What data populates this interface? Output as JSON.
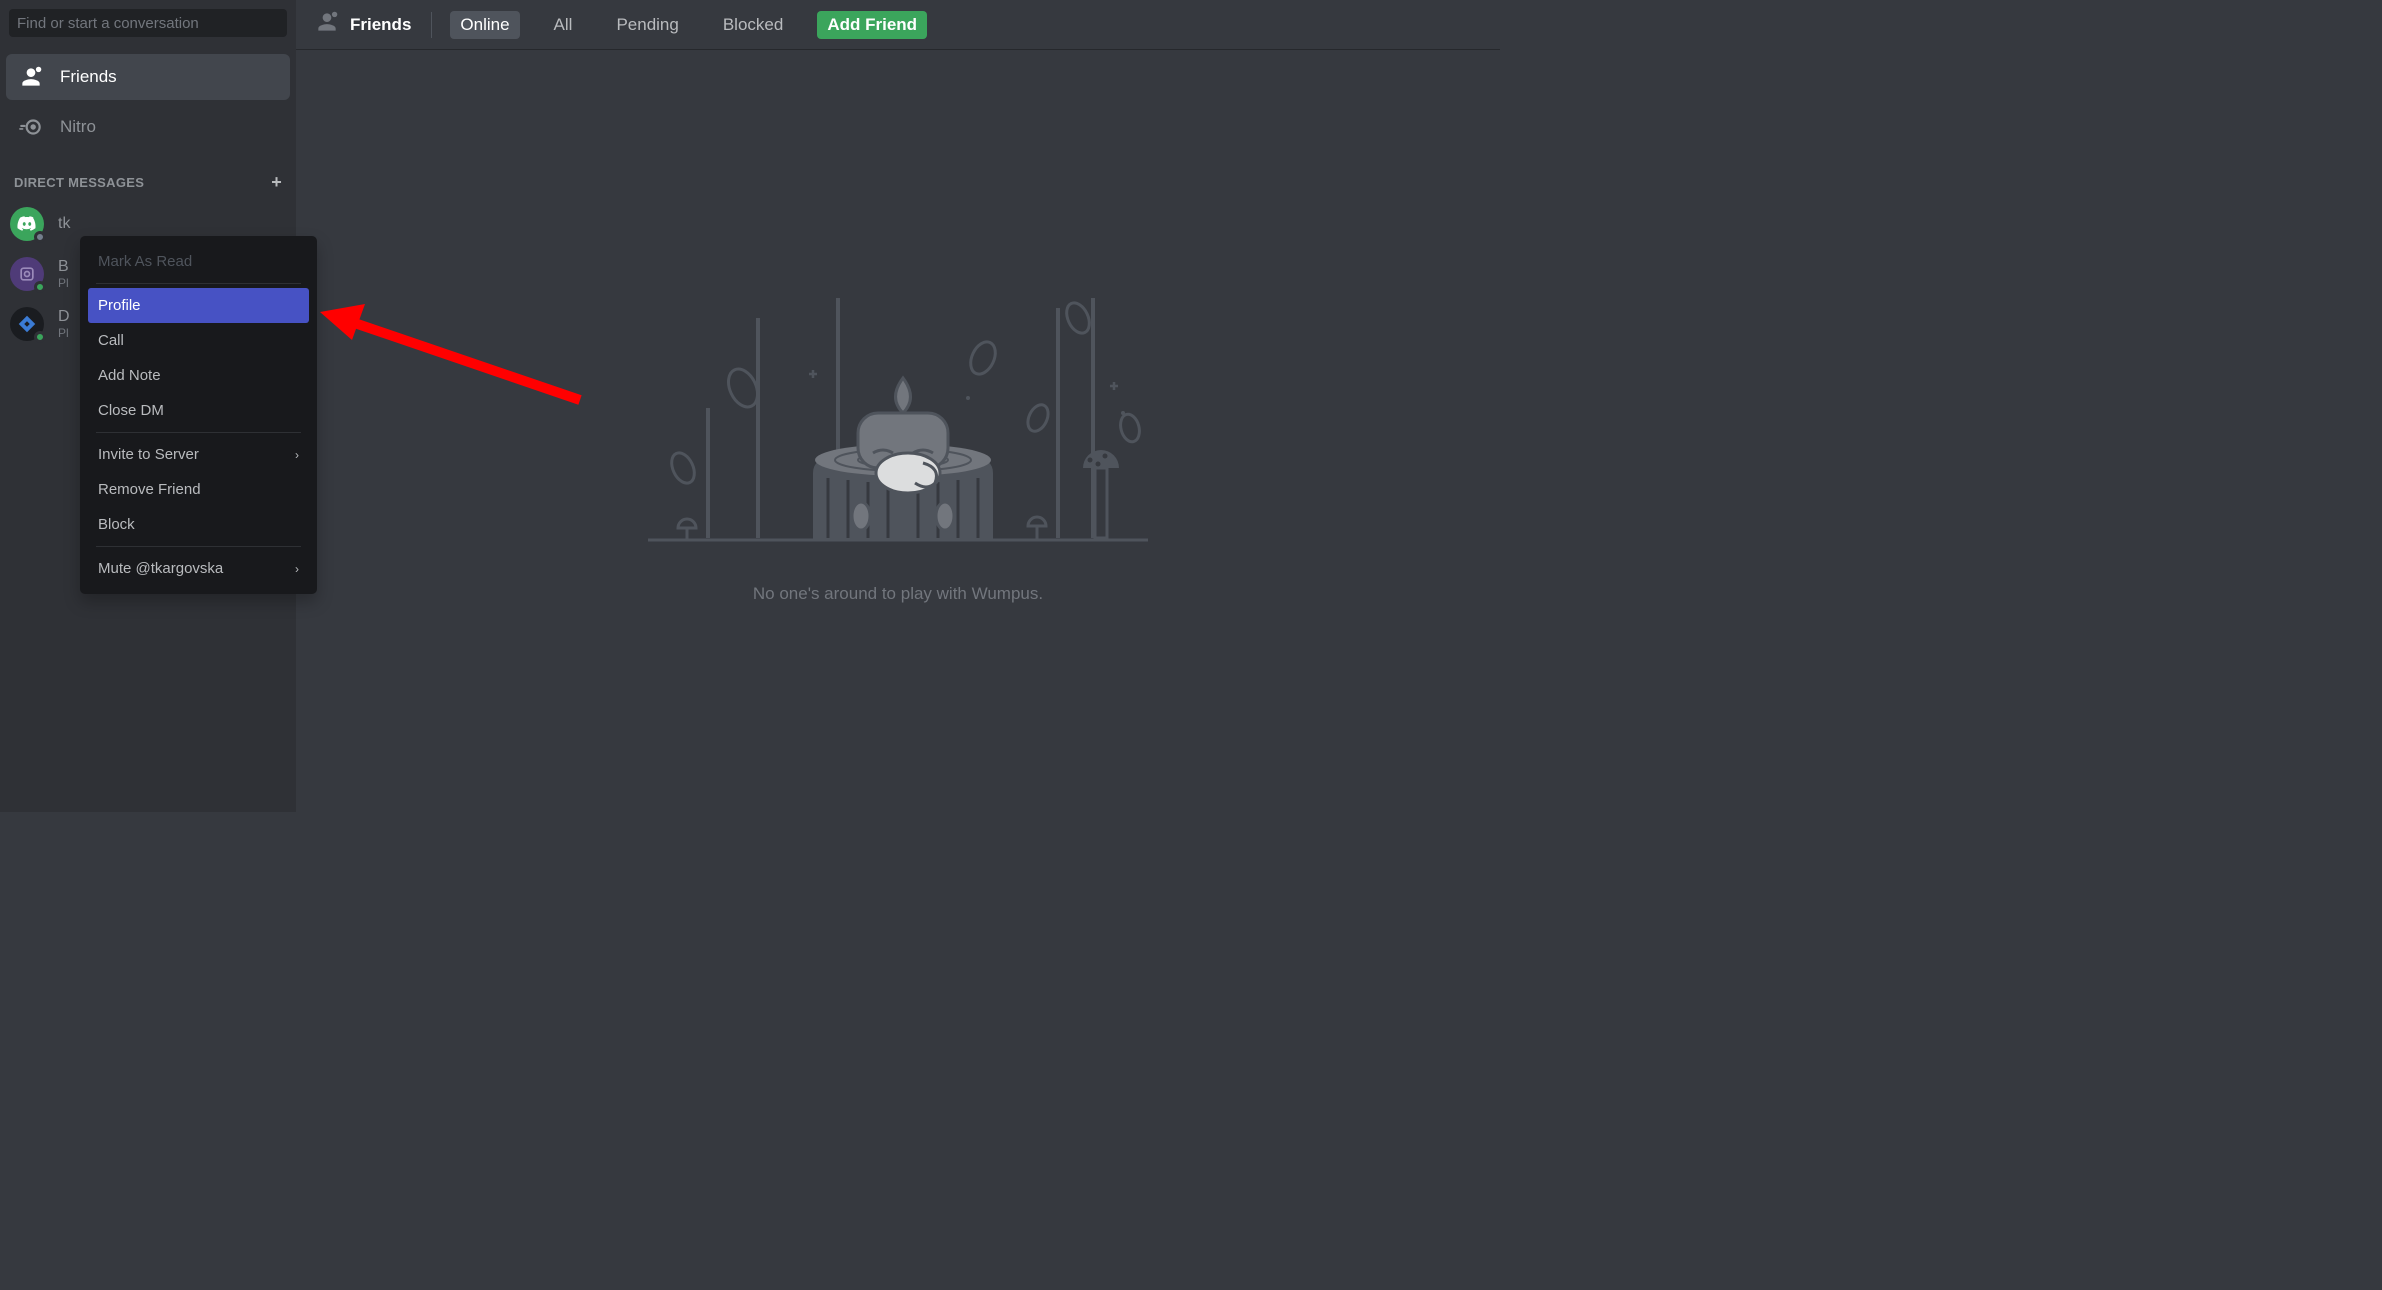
{
  "search": {
    "placeholder": "Find or start a conversation"
  },
  "sidebar": {
    "friends_label": "Friends",
    "nitro_label": "Nitro",
    "dm_header": "DIRECT MESSAGES",
    "dms": [
      {
        "name": "tk",
        "sub": "",
        "avatar_bg": "#3ba55c",
        "status": "#747f8d"
      },
      {
        "name": "B",
        "sub": "Pl",
        "avatar_bg": "#4f3b78",
        "status": "#3ba55c"
      },
      {
        "name": "D",
        "sub": "Pl",
        "avatar_bg": "#1a1c20",
        "status": "#3ba55c"
      }
    ]
  },
  "header": {
    "title": "Friends",
    "tabs": {
      "online": "Online",
      "all": "All",
      "pending": "Pending",
      "blocked": "Blocked"
    },
    "add_friend": "Add Friend"
  },
  "empty": {
    "text": "No one's around to play with Wumpus."
  },
  "context_menu": {
    "mark_read": "Mark As Read",
    "profile": "Profile",
    "call": "Call",
    "add_note": "Add Note",
    "close_dm": "Close DM",
    "invite": "Invite to Server",
    "remove": "Remove Friend",
    "block": "Block",
    "mute": "Mute @tkargovska"
  }
}
